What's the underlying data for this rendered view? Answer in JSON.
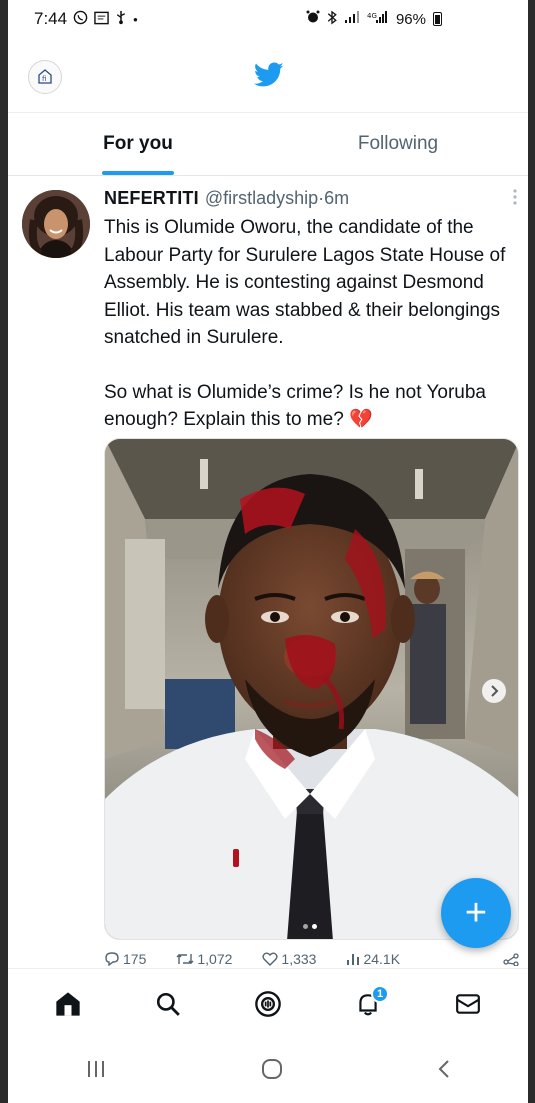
{
  "status_bar": {
    "time": "7:44",
    "battery": "96%",
    "left_icons": [
      "whatsapp-icon",
      "message-icon",
      "usb-icon",
      "dot-icon"
    ],
    "right_icons": [
      "alarm-icon",
      "bluetooth-icon",
      "signal-icon",
      "signal-icon"
    ]
  },
  "header": {
    "logo": "twitter-bird-icon",
    "brand_color": "#1d9bf0"
  },
  "tabs": [
    {
      "label": "For you",
      "active": true
    },
    {
      "label": "Following",
      "active": false
    }
  ],
  "tweet": {
    "display_name": "NEFERTITI",
    "handle": "@firstladyship",
    "separator": " · ",
    "time": "6m",
    "text_p1": "This is Olumide Oworu, the candidate of the Labour Party for Surulere Lagos State House of Assembly. He is contesting against Desmond Elliot. His team was stabbed & their belongings snatched in Surulere.",
    "text_p2": "So what is Olumide’s crime? Is he not Yoruba enough? Explain this to me? 💔",
    "media": {
      "count": 2,
      "current": 2
    },
    "stats": {
      "replies": "175",
      "retweets": "1,072",
      "likes": "1,333",
      "views": "24.1K"
    }
  },
  "fab": {
    "label": "+"
  },
  "bottom_nav": {
    "items": [
      "home-icon",
      "search-icon",
      "spaces-icon",
      "notifications-icon",
      "messages-icon"
    ],
    "notification_count": "1"
  }
}
